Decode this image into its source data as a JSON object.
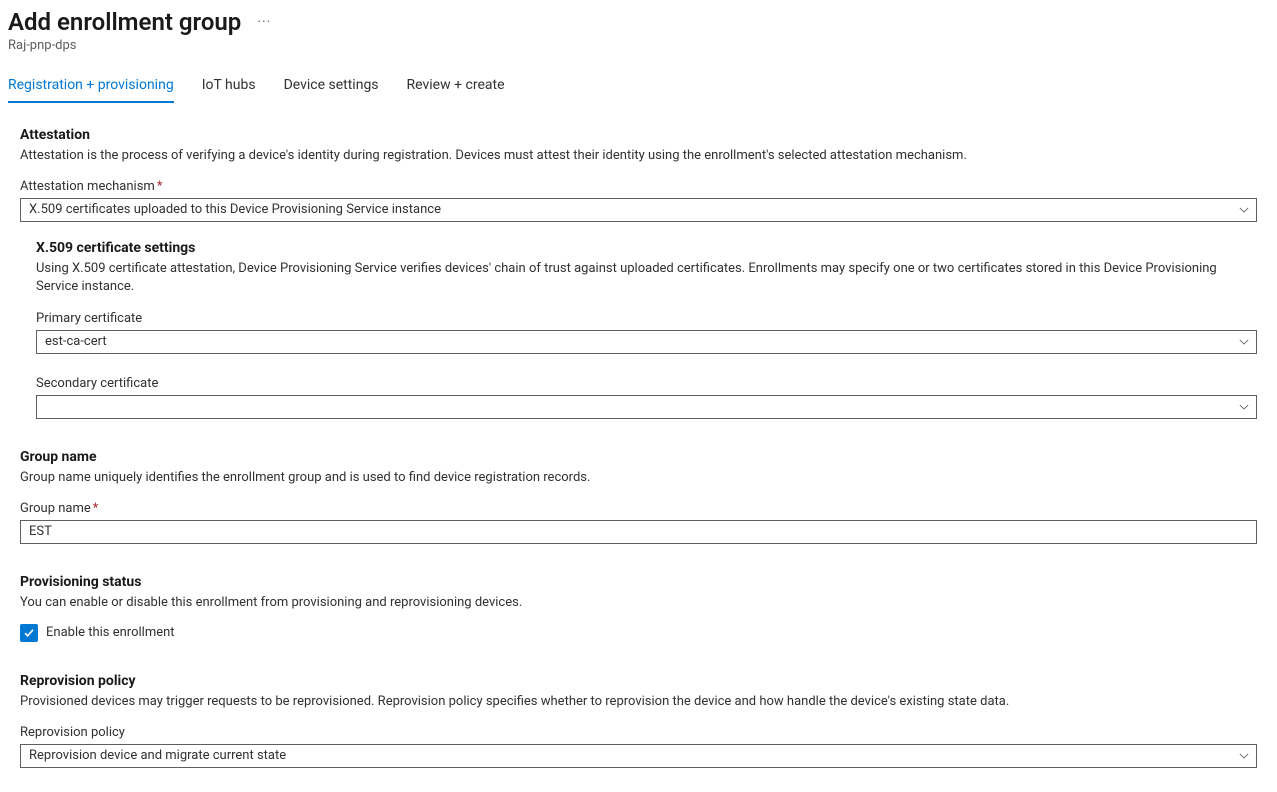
{
  "header": {
    "title": "Add enrollment group",
    "subtitle": "Raj-pnp-dps"
  },
  "tabs": [
    {
      "label": "Registration + provisioning",
      "active": true
    },
    {
      "label": "IoT hubs",
      "active": false
    },
    {
      "label": "Device settings",
      "active": false
    },
    {
      "label": "Review + create",
      "active": false
    }
  ],
  "attestation": {
    "heading": "Attestation",
    "desc": "Attestation is the process of verifying a device's identity during registration. Devices must attest their identity using the enrollment's selected attestation mechanism.",
    "mechanism_label": "Attestation mechanism",
    "mechanism_value": "X.509 certificates uploaded to this Device Provisioning Service instance",
    "x509": {
      "heading": "X.509 certificate settings",
      "desc": "Using X.509 certificate attestation, Device Provisioning Service verifies devices' chain of trust against uploaded certificates. Enrollments may specify one or two certificates stored in this Device Provisioning Service instance.",
      "primary_label": "Primary certificate",
      "primary_value": "est-ca-cert",
      "secondary_label": "Secondary certificate",
      "secondary_value": ""
    }
  },
  "group": {
    "heading": "Group name",
    "desc": "Group name uniquely identifies the enrollment group and is used to find device registration records.",
    "name_label": "Group name",
    "name_value": "EST"
  },
  "provisioning": {
    "heading": "Provisioning status",
    "desc": "You can enable or disable this enrollment from provisioning and reprovisioning devices.",
    "checkbox_label": "Enable this enrollment"
  },
  "reprovision": {
    "heading": "Reprovision policy",
    "desc": "Provisioned devices may trigger requests to be reprovisioned. Reprovision policy specifies whether to reprovision the device and how handle the device's existing state data.",
    "policy_label": "Reprovision policy",
    "policy_value": "Reprovision device and migrate current state"
  }
}
